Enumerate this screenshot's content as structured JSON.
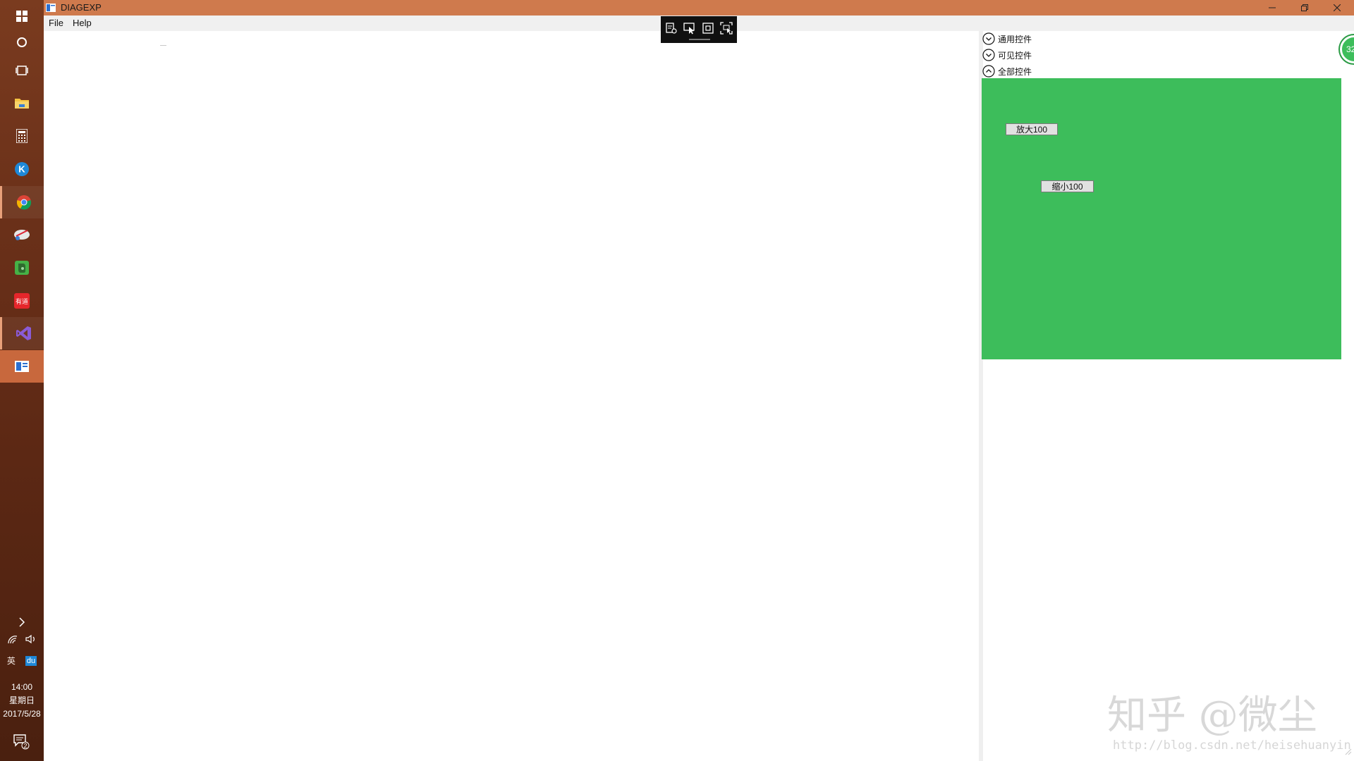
{
  "taskbar": {
    "apps": [
      {
        "name": "start-icon"
      },
      {
        "name": "cortana-icon"
      },
      {
        "name": "task-view-icon"
      },
      {
        "name": "file-explorer-icon"
      },
      {
        "name": "calculator-icon"
      },
      {
        "name": "k-app-icon"
      },
      {
        "name": "chrome-icon"
      },
      {
        "name": "snipping-icon"
      },
      {
        "name": "evernote-icon"
      },
      {
        "name": "youdao-icon"
      },
      {
        "name": "visual-studio-icon"
      },
      {
        "name": "diagexp-app-icon"
      }
    ],
    "tray": {
      "ime_label": "英",
      "baidu_label": "du",
      "time": "14:00",
      "weekday": "星期日",
      "date": "2017/5/28",
      "notification_count": "2"
    }
  },
  "window": {
    "title": "DIAGEXP",
    "menu": {
      "file": "File",
      "help": "Help"
    }
  },
  "right_panel": {
    "sections": [
      {
        "label": "通用控件",
        "state": "collapsed"
      },
      {
        "label": "可见控件",
        "state": "collapsed"
      },
      {
        "label": "全部控件",
        "state": "expanded"
      }
    ],
    "green_color": "#3dbd5b",
    "buttons": {
      "zoom_in": "放大100",
      "zoom_out": "缩小100"
    }
  },
  "badge": {
    "text": "32"
  },
  "watermark": {
    "text": "知乎 @微尘",
    "url": "http://blog.csdn.net/heisehuanyin"
  },
  "colors": {
    "titlebar": "#cf7a4d",
    "taskbar_selected": "#c8683d",
    "accent_green": "#3dbd5b"
  }
}
